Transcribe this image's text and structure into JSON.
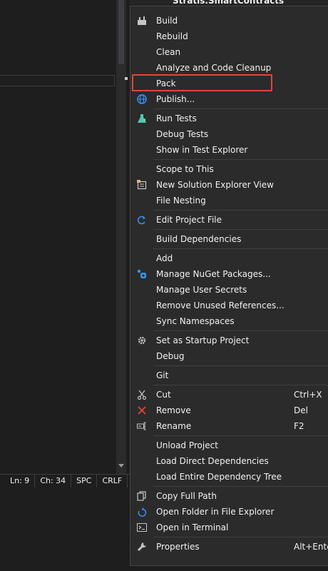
{
  "tree": {
    "partial_item": "Stratis.SmartContracts"
  },
  "status_bar": {
    "line": "Ln: 9",
    "column": "Ch: 34",
    "whitespace": "SPC",
    "line_ending": "CRLF"
  },
  "menu": {
    "highlighted_item": "Pack",
    "groups": [
      [
        {
          "label": "Build",
          "icon": "build-icon"
        },
        {
          "label": "Rebuild"
        },
        {
          "label": "Clean"
        },
        {
          "label": "Analyze and Code Cleanup"
        },
        {
          "label": "Pack"
        },
        {
          "label": "Publish...",
          "icon": "globe-icon"
        }
      ],
      [
        {
          "label": "Run Tests",
          "icon": "test-flask-icon"
        },
        {
          "label": "Debug Tests"
        },
        {
          "label": "Show in Test Explorer"
        }
      ],
      [
        {
          "label": "Scope to This"
        },
        {
          "label": "New Solution Explorer View",
          "icon": "new-view-icon"
        },
        {
          "label": "File Nesting"
        }
      ],
      [
        {
          "label": "Edit Project File",
          "icon": "refresh-arrow-icon"
        }
      ],
      [
        {
          "label": "Build Dependencies"
        }
      ],
      [
        {
          "label": "Add"
        },
        {
          "label": "Manage NuGet Packages...",
          "icon": "nuget-icon"
        },
        {
          "label": "Manage User Secrets"
        },
        {
          "label": "Remove Unused References..."
        },
        {
          "label": "Sync Namespaces"
        }
      ],
      [
        {
          "label": "Set as Startup Project",
          "icon": "gear-icon"
        },
        {
          "label": "Debug"
        }
      ],
      [
        {
          "label": "Git"
        }
      ],
      [
        {
          "label": "Cut",
          "icon": "scissors-icon",
          "shortcut": "Ctrl+X"
        },
        {
          "label": "Remove",
          "icon": "remove-x-icon",
          "shortcut": "Del"
        },
        {
          "label": "Rename",
          "icon": "rename-icon",
          "shortcut": "F2"
        }
      ],
      [
        {
          "label": "Unload Project"
        },
        {
          "label": "Load Direct Dependencies"
        },
        {
          "label": "Load Entire Dependency Tree"
        }
      ],
      [
        {
          "label": "Copy Full Path",
          "icon": "copy-icon"
        },
        {
          "label": "Open Folder in File Explorer",
          "icon": "open-folder-icon"
        },
        {
          "label": "Open in Terminal",
          "icon": "terminal-icon"
        }
      ],
      [
        {
          "label": "Properties",
          "icon": "wrench-icon",
          "shortcut": "Alt+Enter"
        }
      ]
    ]
  }
}
